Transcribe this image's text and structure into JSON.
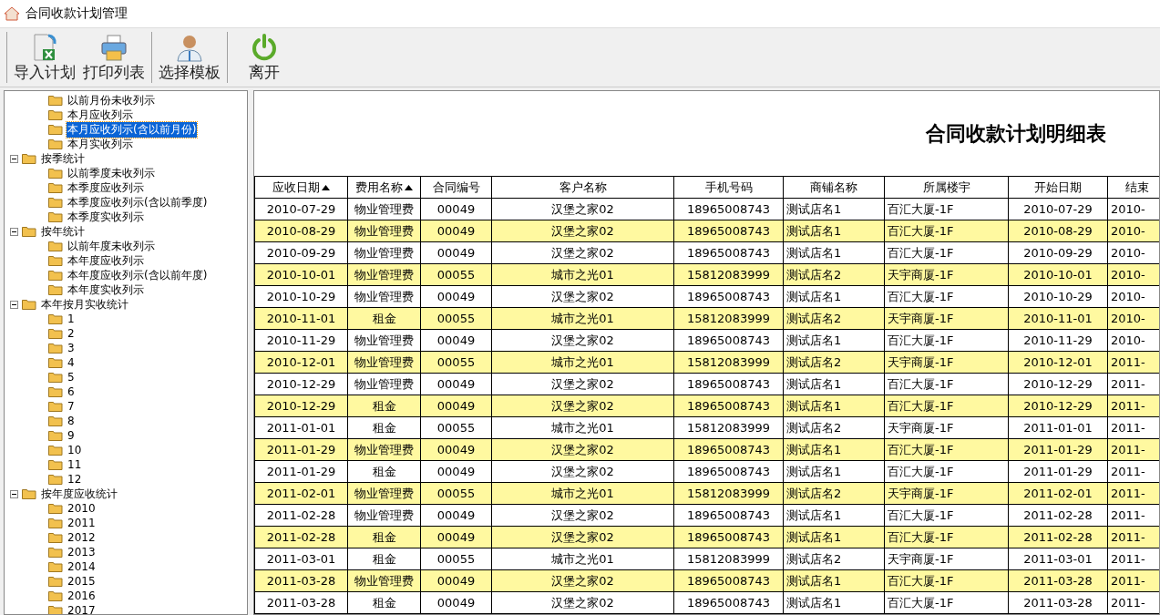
{
  "window": {
    "title": "合同收款计划管理"
  },
  "toolbar": [
    {
      "kind": "import",
      "label": "导入计划"
    },
    {
      "kind": "print",
      "label": "打印列表"
    },
    {
      "kind": "template",
      "label": "选择模板"
    },
    {
      "kind": "exit",
      "label": "离开"
    }
  ],
  "tree": [
    {
      "children": [
        {
          "label": "以前月份未收列示",
          "selected": false
        },
        {
          "label": "本月应收列示",
          "selected": false
        },
        {
          "label": "本月应收列示(含以前月份)",
          "selected": true
        },
        {
          "label": "本月实收列示",
          "selected": false
        }
      ]
    },
    {
      "label": "按季统计",
      "expanded": true,
      "selected": false,
      "children": [
        {
          "label": "以前季度未收列示",
          "selected": false
        },
        {
          "label": "本季度应收列示",
          "selected": false
        },
        {
          "label": "本季度应收列示(含以前季度)",
          "selected": false
        },
        {
          "label": "本季度实收列示",
          "selected": false
        }
      ]
    },
    {
      "label": "按年统计",
      "expanded": true,
      "selected": false,
      "children": [
        {
          "label": "以前年度未收列示",
          "selected": false
        },
        {
          "label": "本年度应收列示",
          "selected": false
        },
        {
          "label": "本年度应收列示(含以前年度)",
          "selected": false
        },
        {
          "label": "本年度实收列示",
          "selected": false
        }
      ]
    },
    {
      "label": "本年按月实收统计",
      "expanded": true,
      "selected": false,
      "children": [
        {
          "label": "1",
          "selected": false
        },
        {
          "label": "2",
          "selected": false
        },
        {
          "label": "3",
          "selected": false
        },
        {
          "label": "4",
          "selected": false
        },
        {
          "label": "5",
          "selected": false
        },
        {
          "label": "6",
          "selected": false
        },
        {
          "label": "7",
          "selected": false
        },
        {
          "label": "8",
          "selected": false
        },
        {
          "label": "9",
          "selected": false
        },
        {
          "label": "10",
          "selected": false
        },
        {
          "label": "11",
          "selected": false
        },
        {
          "label": "12",
          "selected": false
        }
      ]
    },
    {
      "label": "按年度应收统计",
      "expanded": true,
      "selected": false,
      "children": [
        {
          "label": "2010",
          "selected": false
        },
        {
          "label": "2011",
          "selected": false
        },
        {
          "label": "2012",
          "selected": false
        },
        {
          "label": "2013",
          "selected": false
        },
        {
          "label": "2014",
          "selected": false
        },
        {
          "label": "2015",
          "selected": false
        },
        {
          "label": "2016",
          "selected": false
        },
        {
          "label": "2017",
          "selected": false
        }
      ]
    }
  ],
  "report": {
    "title": "合同收款计划明细表",
    "columns": [
      {
        "label": "应收日期",
        "sorted": true
      },
      {
        "label": "费用名称",
        "sorted": true
      },
      {
        "label": "合同编号",
        "sorted": false
      },
      {
        "label": "客户名称",
        "sorted": false
      },
      {
        "label": "手机号码",
        "sorted": false
      },
      {
        "label": "商铺名称",
        "sorted": false
      },
      {
        "label": "所属楼宇",
        "sorted": false
      },
      {
        "label": "开始日期",
        "sorted": false
      },
      {
        "label": "结束",
        "sorted": false
      }
    ],
    "rows": [
      [
        "2010-07-29",
        "物业管理费",
        "00049",
        "汉堡之家02",
        "18965008743",
        "测试店名1",
        "百汇大厦-1F",
        "2010-07-29",
        "2010-"
      ],
      [
        "2010-08-29",
        "物业管理费",
        "00049",
        "汉堡之家02",
        "18965008743",
        "测试店名1",
        "百汇大厦-1F",
        "2010-08-29",
        "2010-"
      ],
      [
        "2010-09-29",
        "物业管理费",
        "00049",
        "汉堡之家02",
        "18965008743",
        "测试店名1",
        "百汇大厦-1F",
        "2010-09-29",
        "2010-"
      ],
      [
        "2010-10-01",
        "物业管理费",
        "00055",
        "城市之光01",
        "15812083999",
        "测试店名2",
        "天宇商厦-1F",
        "2010-10-01",
        "2010-"
      ],
      [
        "2010-10-29",
        "物业管理费",
        "00049",
        "汉堡之家02",
        "18965008743",
        "测试店名1",
        "百汇大厦-1F",
        "2010-10-29",
        "2010-"
      ],
      [
        "2010-11-01",
        "租金",
        "00055",
        "城市之光01",
        "15812083999",
        "测试店名2",
        "天宇商厦-1F",
        "2010-11-01",
        "2010-"
      ],
      [
        "2010-11-29",
        "物业管理费",
        "00049",
        "汉堡之家02",
        "18965008743",
        "测试店名1",
        "百汇大厦-1F",
        "2010-11-29",
        "2010-"
      ],
      [
        "2010-12-01",
        "物业管理费",
        "00055",
        "城市之光01",
        "15812083999",
        "测试店名2",
        "天宇商厦-1F",
        "2010-12-01",
        "2011-"
      ],
      [
        "2010-12-29",
        "物业管理费",
        "00049",
        "汉堡之家02",
        "18965008743",
        "测试店名1",
        "百汇大厦-1F",
        "2010-12-29",
        "2011-"
      ],
      [
        "2010-12-29",
        "租金",
        "00049",
        "汉堡之家02",
        "18965008743",
        "测试店名1",
        "百汇大厦-1F",
        "2010-12-29",
        "2011-"
      ],
      [
        "2011-01-01",
        "租金",
        "00055",
        "城市之光01",
        "15812083999",
        "测试店名2",
        "天宇商厦-1F",
        "2011-01-01",
        "2011-"
      ],
      [
        "2011-01-29",
        "物业管理费",
        "00049",
        "汉堡之家02",
        "18965008743",
        "测试店名1",
        "百汇大厦-1F",
        "2011-01-29",
        "2011-"
      ],
      [
        "2011-01-29",
        "租金",
        "00049",
        "汉堡之家02",
        "18965008743",
        "测试店名1",
        "百汇大厦-1F",
        "2011-01-29",
        "2011-"
      ],
      [
        "2011-02-01",
        "物业管理费",
        "00055",
        "城市之光01",
        "15812083999",
        "测试店名2",
        "天宇商厦-1F",
        "2011-02-01",
        "2011-"
      ],
      [
        "2011-02-28",
        "物业管理费",
        "00049",
        "汉堡之家02",
        "18965008743",
        "测试店名1",
        "百汇大厦-1F",
        "2011-02-28",
        "2011-"
      ],
      [
        "2011-02-28",
        "租金",
        "00049",
        "汉堡之家02",
        "18965008743",
        "测试店名1",
        "百汇大厦-1F",
        "2011-02-28",
        "2011-"
      ],
      [
        "2011-03-01",
        "租金",
        "00055",
        "城市之光01",
        "15812083999",
        "测试店名2",
        "天宇商厦-1F",
        "2011-03-01",
        "2011-"
      ],
      [
        "2011-03-28",
        "物业管理费",
        "00049",
        "汉堡之家02",
        "18965008743",
        "测试店名1",
        "百汇大厦-1F",
        "2011-03-28",
        "2011-"
      ],
      [
        "2011-03-28",
        "租金",
        "00049",
        "汉堡之家02",
        "18965008743",
        "测试店名1",
        "百汇大厦-1F",
        "2011-03-28",
        "2011-"
      ]
    ]
  }
}
